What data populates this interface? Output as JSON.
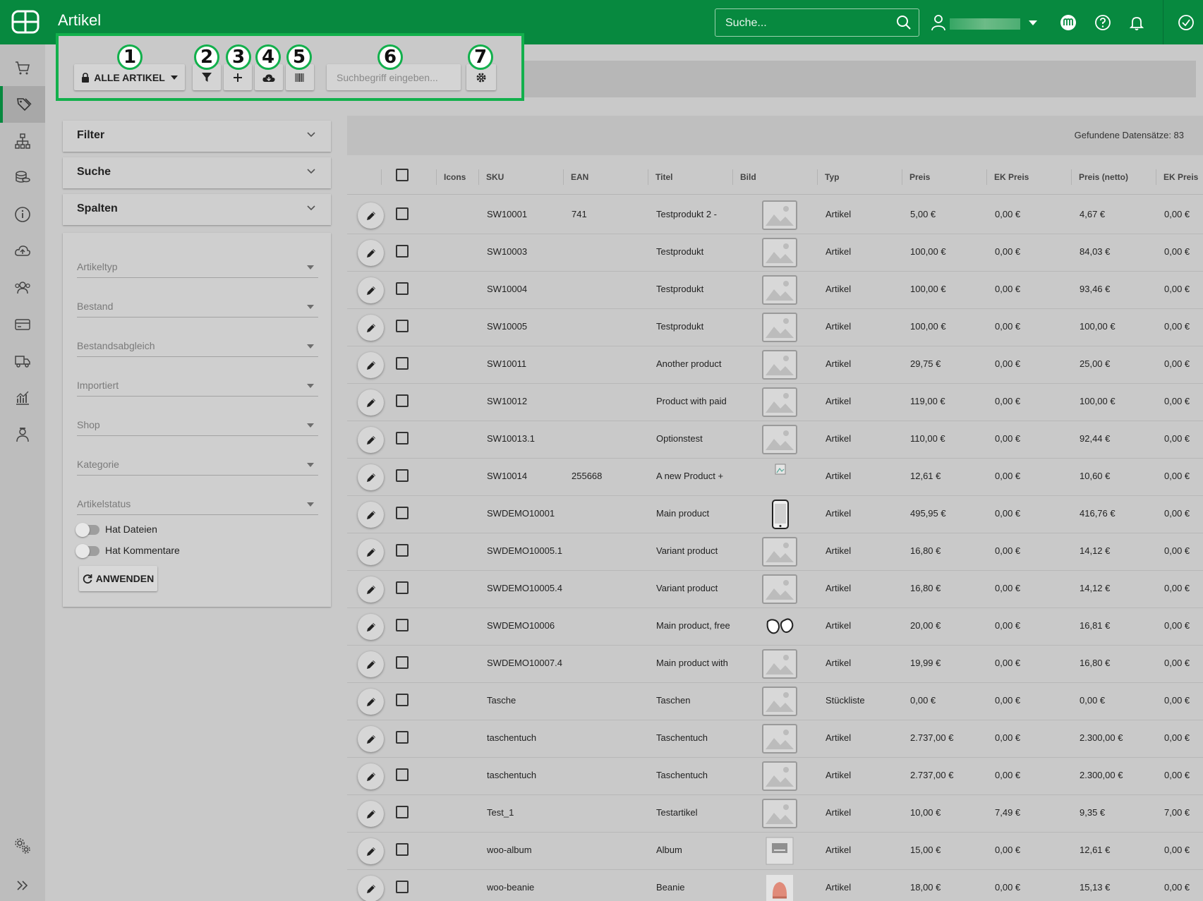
{
  "app": {
    "title": "Artikel"
  },
  "topbar": {
    "search_placeholder": "Suche...",
    "brand_color": "#07893f"
  },
  "toolbar": {
    "all_articles_label": "ALLE ARTIKEL",
    "search_placeholder": "Suchbegriff eingeben...",
    "callouts": [
      "1",
      "2",
      "3",
      "4",
      "5",
      "6",
      "7"
    ]
  },
  "panels": {
    "filter": "Filter",
    "search": "Suche",
    "columns": "Spalten"
  },
  "filters": {
    "fields": [
      "Artikeltyp",
      "Bestand",
      "Bestandsabgleich",
      "Importiert",
      "Shop",
      "Kategorie",
      "Artikelstatus"
    ],
    "toggles": [
      "Hat Dateien",
      "Hat Kommentare"
    ],
    "apply_label": "ANWENDEN"
  },
  "grid": {
    "records_label": "Gefundene Datensätze: 83",
    "columns": [
      "Icons",
      "SKU",
      "EAN",
      "Titel",
      "Bild",
      "Typ",
      "Preis",
      "EK Preis",
      "Preis (netto)",
      "EK Preis"
    ],
    "rows": [
      {
        "sku": "SW10001",
        "ean": "741",
        "title": "Testprodukt 2 -",
        "image": "placeholder",
        "type": "Artikel",
        "price": "5,00 €",
        "ek": "0,00 €",
        "net": "4,67 €",
        "ek2": "0,00 €"
      },
      {
        "sku": "SW10003",
        "ean": "",
        "title": "Testprodukt",
        "image": "placeholder",
        "type": "Artikel",
        "price": "100,00 €",
        "ek": "0,00 €",
        "net": "84,03 €",
        "ek2": "0,00 €"
      },
      {
        "sku": "SW10004",
        "ean": "",
        "title": "Testprodukt",
        "image": "placeholder",
        "type": "Artikel",
        "price": "100,00 €",
        "ek": "0,00 €",
        "net": "93,46 €",
        "ek2": "0,00 €"
      },
      {
        "sku": "SW10005",
        "ean": "",
        "title": "Testprodukt",
        "image": "placeholder",
        "type": "Artikel",
        "price": "100,00 €",
        "ek": "0,00 €",
        "net": "100,00 €",
        "ek2": "0,00 €"
      },
      {
        "sku": "SW10011",
        "ean": "",
        "title": "Another product",
        "image": "placeholder",
        "type": "Artikel",
        "price": "29,75 €",
        "ek": "0,00 €",
        "net": "25,00 €",
        "ek2": "0,00 €"
      },
      {
        "sku": "SW10012",
        "ean": "",
        "title": "Product with paid",
        "image": "placeholder",
        "type": "Artikel",
        "price": "119,00 €",
        "ek": "0,00 €",
        "net": "100,00 €",
        "ek2": "0,00 €"
      },
      {
        "sku": "SW10013.1",
        "ean": "",
        "title": "Optionstest",
        "image": "placeholder",
        "type": "Artikel",
        "price": "110,00 €",
        "ek": "0,00 €",
        "net": "92,44 €",
        "ek2": "0,00 €"
      },
      {
        "sku": "SW10014",
        "ean": "255668",
        "title": "A new Product +",
        "image": "broken",
        "type": "Artikel",
        "price": "12,61 €",
        "ek": "0,00 €",
        "net": "10,60 €",
        "ek2": "0,00 €"
      },
      {
        "sku": "SWDEMO10001",
        "ean": "",
        "title": "Main product",
        "image": "phone",
        "type": "Artikel",
        "price": "495,95 €",
        "ek": "0,00 €",
        "net": "416,76 €",
        "ek2": "0,00 €"
      },
      {
        "sku": "SWDEMO10005.1",
        "ean": "",
        "title": "Variant product",
        "image": "placeholder",
        "type": "Artikel",
        "price": "16,80 €",
        "ek": "0,00 €",
        "net": "14,12 €",
        "ek2": "0,00 €"
      },
      {
        "sku": "SWDEMO10005.4",
        "ean": "",
        "title": "Variant product",
        "image": "placeholder",
        "type": "Artikel",
        "price": "16,80 €",
        "ek": "0,00 €",
        "net": "14,12 €",
        "ek2": "0,00 €"
      },
      {
        "sku": "SWDEMO10006",
        "ean": "",
        "title": "Main product, free",
        "image": "gloves",
        "type": "Artikel",
        "price": "20,00 €",
        "ek": "0,00 €",
        "net": "16,81 €",
        "ek2": "0,00 €"
      },
      {
        "sku": "SWDEMO10007.4",
        "ean": "",
        "title": "Main product with",
        "image": "placeholder",
        "type": "Artikel",
        "price": "19,99 €",
        "ek": "0,00 €",
        "net": "16,80 €",
        "ek2": "0,00 €"
      },
      {
        "sku": "Tasche",
        "ean": "",
        "title": "Taschen",
        "image": "placeholder",
        "type": "Stückliste",
        "price": "0,00 €",
        "ek": "0,00 €",
        "net": "0,00 €",
        "ek2": "0,00 €"
      },
      {
        "sku": "taschentuch",
        "ean": "",
        "title": "Taschentuch",
        "image": "placeholder",
        "type": "Artikel",
        "price": "2.737,00 €",
        "ek": "0,00 €",
        "net": "2.300,00 €",
        "ek2": "0,00 €"
      },
      {
        "sku": "taschentuch",
        "ean": "",
        "title": "Taschentuch",
        "image": "placeholder",
        "type": "Artikel",
        "price": "2.737,00 €",
        "ek": "0,00 €",
        "net": "2.300,00 €",
        "ek2": "0,00 €"
      },
      {
        "sku": "Test_1",
        "ean": "",
        "title": "Testartikel",
        "image": "placeholder",
        "type": "Artikel",
        "price": "10,00 €",
        "ek": "7,49 €",
        "net": "9,35 €",
        "ek2": "7,00 €"
      },
      {
        "sku": "woo-album",
        "ean": "",
        "title": "Album",
        "image": "album",
        "type": "Artikel",
        "price": "15,00 €",
        "ek": "0,00 €",
        "net": "12,61 €",
        "ek2": "0,00 €"
      },
      {
        "sku": "woo-beanie",
        "ean": "",
        "title": "Beanie",
        "image": "beanie",
        "type": "Artikel",
        "price": "18,00 €",
        "ek": "0,00 €",
        "net": "15,13 €",
        "ek2": "0,00 €"
      }
    ]
  }
}
